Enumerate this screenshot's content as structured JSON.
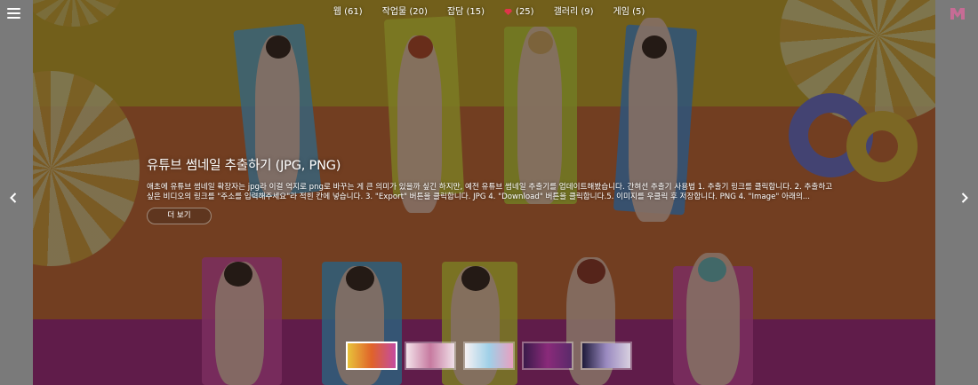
{
  "nav": {
    "items": [
      {
        "label": "웹 (61)"
      },
      {
        "label": "작업물 (20)"
      },
      {
        "label": "잡담 (15)"
      },
      {
        "label": "(25)",
        "icon": "ruby-gem-icon"
      },
      {
        "label": "갤러리 (9)"
      },
      {
        "label": "게임 (5)"
      }
    ]
  },
  "icons": {
    "menu": "hamburger-menu-icon",
    "logo": "m-logo-icon",
    "prev": "chevron-left-icon",
    "next": "chevron-right-icon"
  },
  "slide": {
    "title": "유튜브 썸네일 추출하기 (JPG, PNG)",
    "excerpt": "애초에 유튜브 썸네일 확장자는 jpg라 이걸 억지로 png로 바꾸는 게 큰 의미가 있을까 싶긴 하지만, 예전 유튜브 썸네일 추출기를 업데이트해봤습니다. 간혀선 추출기 사용법 1. 추출기 링크를 클릭합니다. 2. 추출하고 싶은 비디오의 링크를 \"주소를 입력해주세요\"라 적힌 칸에 넣습니다. 3. \"Export\" 버튼을 클릭합니다. JPG 4. \"Download\" 버튼을 클릭합니다.5. 이미지를 우클릭 후 저장합니다. PNG 4. \"Image\" 아래의...",
    "more_label": "더 보기"
  },
  "thumbnails": [
    {
      "active": true,
      "colors": [
        "#e8c23a",
        "#e0632a",
        "#c44ba0"
      ]
    },
    {
      "active": false,
      "colors": [
        "#f3e3ea",
        "#c77aa0",
        "#efe0e8"
      ]
    },
    {
      "active": false,
      "colors": [
        "#f6f1f3",
        "#9fd0e8",
        "#e8a0c0"
      ]
    },
    {
      "active": false,
      "colors": [
        "#3a1a4a",
        "#8a2a7a",
        "#5a2a6a"
      ]
    },
    {
      "active": false,
      "colors": [
        "#1e1a3a",
        "#9a8ac0",
        "#d8d0e0"
      ]
    }
  ],
  "colors": {
    "accent_pink": "#e0344a",
    "logo_pink": "#d46a9a"
  }
}
